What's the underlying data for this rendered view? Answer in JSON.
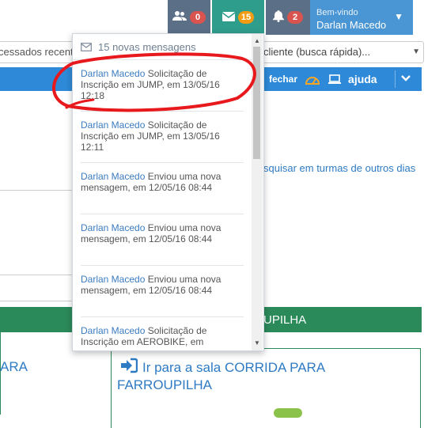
{
  "navbar": {
    "groups_badge": "0",
    "messages_badge": "15",
    "notifications_badge": "2",
    "welcome": "Bem-vindo",
    "user_name": "Darlan Macedo"
  },
  "search": {
    "left_text": "cessados recent",
    "right_text": "cliente (busca rápida)..."
  },
  "toolbar": {
    "close_label": "fechar",
    "help_label": "ajuda"
  },
  "page": {
    "search_other_days_link": "squisar em turmas de outros dias",
    "section_title": "UPILHA",
    "left_panel_text": "ARA",
    "room_link": "Ir para a sala CORRIDA PARA FARROUPILHA"
  },
  "messages": {
    "header": "15 novas mensagens",
    "items": [
      {
        "sender": "Darlan Macedo",
        "text": "Solicitação de Inscrição em JUMP, em 13/05/16 12:18"
      },
      {
        "sender": "Darlan Macedo",
        "text": "Solicitação de Inscrição em JUMP, em 13/05/16 12:11"
      },
      {
        "sender": "Darlan Macedo",
        "text": "Enviou uma nova mensagem, em 12/05/16 08:44"
      },
      {
        "sender": "Darlan Macedo",
        "text": "Enviou uma nova mensagem, em 12/05/16 08:44"
      },
      {
        "sender": "Darlan Macedo",
        "text": "Enviou uma nova mensagem, em 12/05/16 08:44"
      },
      {
        "sender": "Darlan Macedo",
        "text": "Solicitação de Inscrição em AEROBIKE, em"
      }
    ]
  },
  "colors": {
    "accent_blue": "#2e8ad8",
    "nav_green": "#2f9d8c",
    "section_green": "#2b8a5a",
    "annotation_red": "#e8191d"
  }
}
